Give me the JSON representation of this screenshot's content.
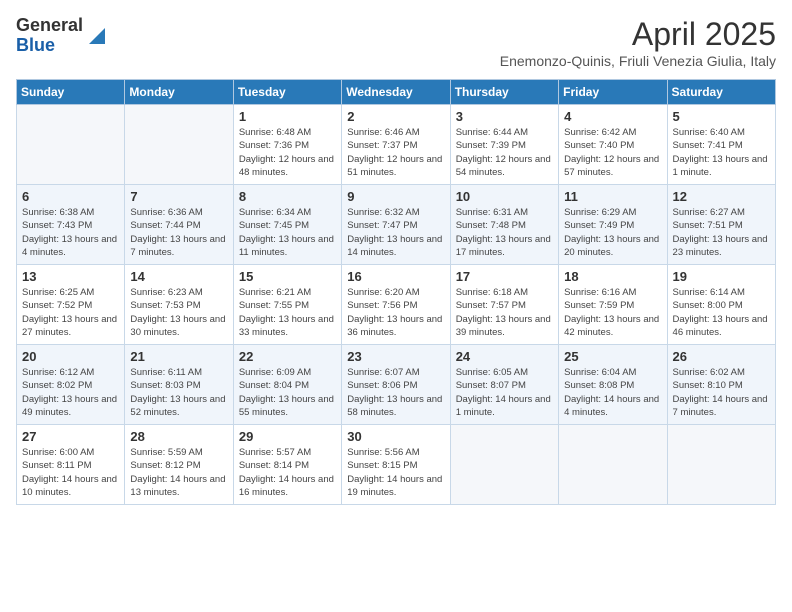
{
  "logo": {
    "general": "General",
    "blue": "Blue"
  },
  "title": "April 2025",
  "subtitle": "Enemonzo-Quinis, Friuli Venezia Giulia, Italy",
  "days_of_week": [
    "Sunday",
    "Monday",
    "Tuesday",
    "Wednesday",
    "Thursday",
    "Friday",
    "Saturday"
  ],
  "weeks": [
    [
      {
        "day": "",
        "info": ""
      },
      {
        "day": "",
        "info": ""
      },
      {
        "day": "1",
        "info": "Sunrise: 6:48 AM\nSunset: 7:36 PM\nDaylight: 12 hours and 48 minutes."
      },
      {
        "day": "2",
        "info": "Sunrise: 6:46 AM\nSunset: 7:37 PM\nDaylight: 12 hours and 51 minutes."
      },
      {
        "day": "3",
        "info": "Sunrise: 6:44 AM\nSunset: 7:39 PM\nDaylight: 12 hours and 54 minutes."
      },
      {
        "day": "4",
        "info": "Sunrise: 6:42 AM\nSunset: 7:40 PM\nDaylight: 12 hours and 57 minutes."
      },
      {
        "day": "5",
        "info": "Sunrise: 6:40 AM\nSunset: 7:41 PM\nDaylight: 13 hours and 1 minute."
      }
    ],
    [
      {
        "day": "6",
        "info": "Sunrise: 6:38 AM\nSunset: 7:43 PM\nDaylight: 13 hours and 4 minutes."
      },
      {
        "day": "7",
        "info": "Sunrise: 6:36 AM\nSunset: 7:44 PM\nDaylight: 13 hours and 7 minutes."
      },
      {
        "day": "8",
        "info": "Sunrise: 6:34 AM\nSunset: 7:45 PM\nDaylight: 13 hours and 11 minutes."
      },
      {
        "day": "9",
        "info": "Sunrise: 6:32 AM\nSunset: 7:47 PM\nDaylight: 13 hours and 14 minutes."
      },
      {
        "day": "10",
        "info": "Sunrise: 6:31 AM\nSunset: 7:48 PM\nDaylight: 13 hours and 17 minutes."
      },
      {
        "day": "11",
        "info": "Sunrise: 6:29 AM\nSunset: 7:49 PM\nDaylight: 13 hours and 20 minutes."
      },
      {
        "day": "12",
        "info": "Sunrise: 6:27 AM\nSunset: 7:51 PM\nDaylight: 13 hours and 23 minutes."
      }
    ],
    [
      {
        "day": "13",
        "info": "Sunrise: 6:25 AM\nSunset: 7:52 PM\nDaylight: 13 hours and 27 minutes."
      },
      {
        "day": "14",
        "info": "Sunrise: 6:23 AM\nSunset: 7:53 PM\nDaylight: 13 hours and 30 minutes."
      },
      {
        "day": "15",
        "info": "Sunrise: 6:21 AM\nSunset: 7:55 PM\nDaylight: 13 hours and 33 minutes."
      },
      {
        "day": "16",
        "info": "Sunrise: 6:20 AM\nSunset: 7:56 PM\nDaylight: 13 hours and 36 minutes."
      },
      {
        "day": "17",
        "info": "Sunrise: 6:18 AM\nSunset: 7:57 PM\nDaylight: 13 hours and 39 minutes."
      },
      {
        "day": "18",
        "info": "Sunrise: 6:16 AM\nSunset: 7:59 PM\nDaylight: 13 hours and 42 minutes."
      },
      {
        "day": "19",
        "info": "Sunrise: 6:14 AM\nSunset: 8:00 PM\nDaylight: 13 hours and 46 minutes."
      }
    ],
    [
      {
        "day": "20",
        "info": "Sunrise: 6:12 AM\nSunset: 8:02 PM\nDaylight: 13 hours and 49 minutes."
      },
      {
        "day": "21",
        "info": "Sunrise: 6:11 AM\nSunset: 8:03 PM\nDaylight: 13 hours and 52 minutes."
      },
      {
        "day": "22",
        "info": "Sunrise: 6:09 AM\nSunset: 8:04 PM\nDaylight: 13 hours and 55 minutes."
      },
      {
        "day": "23",
        "info": "Sunrise: 6:07 AM\nSunset: 8:06 PM\nDaylight: 13 hours and 58 minutes."
      },
      {
        "day": "24",
        "info": "Sunrise: 6:05 AM\nSunset: 8:07 PM\nDaylight: 14 hours and 1 minute."
      },
      {
        "day": "25",
        "info": "Sunrise: 6:04 AM\nSunset: 8:08 PM\nDaylight: 14 hours and 4 minutes."
      },
      {
        "day": "26",
        "info": "Sunrise: 6:02 AM\nSunset: 8:10 PM\nDaylight: 14 hours and 7 minutes."
      }
    ],
    [
      {
        "day": "27",
        "info": "Sunrise: 6:00 AM\nSunset: 8:11 PM\nDaylight: 14 hours and 10 minutes."
      },
      {
        "day": "28",
        "info": "Sunrise: 5:59 AM\nSunset: 8:12 PM\nDaylight: 14 hours and 13 minutes."
      },
      {
        "day": "29",
        "info": "Sunrise: 5:57 AM\nSunset: 8:14 PM\nDaylight: 14 hours and 16 minutes."
      },
      {
        "day": "30",
        "info": "Sunrise: 5:56 AM\nSunset: 8:15 PM\nDaylight: 14 hours and 19 minutes."
      },
      {
        "day": "",
        "info": ""
      },
      {
        "day": "",
        "info": ""
      },
      {
        "day": "",
        "info": ""
      }
    ]
  ]
}
